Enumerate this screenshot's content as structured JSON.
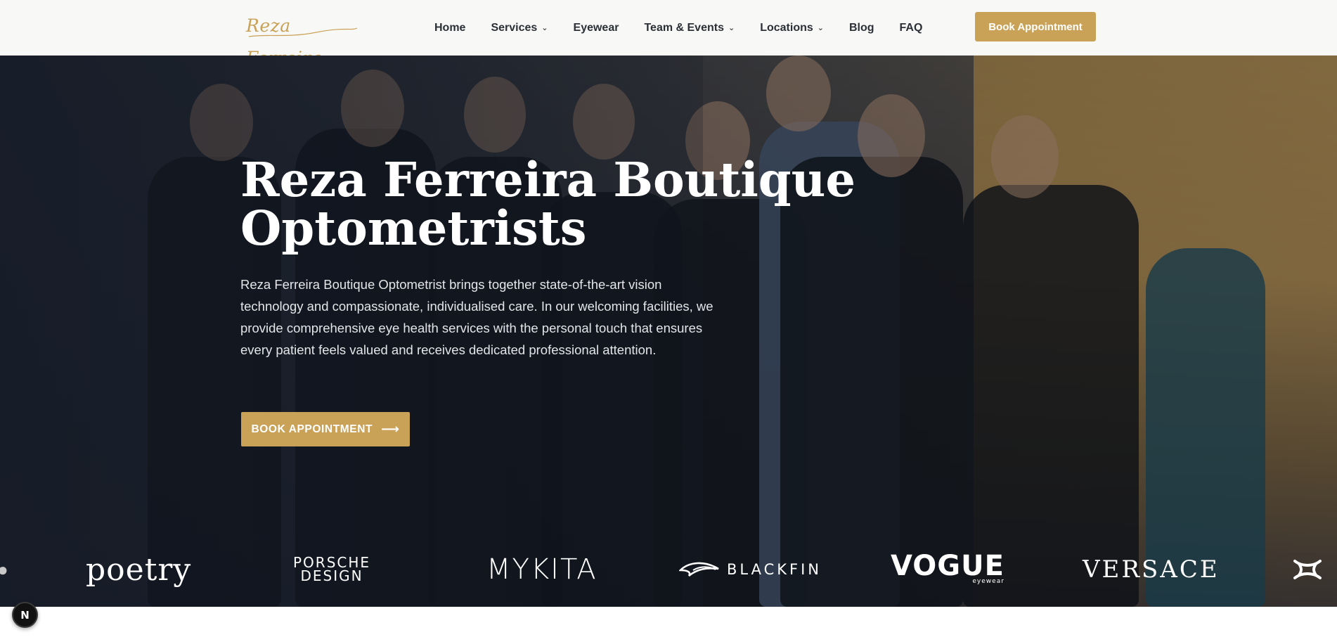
{
  "header": {
    "logo_text": "Reza Ferreira",
    "nav": [
      {
        "label": "Home",
        "has_dropdown": false
      },
      {
        "label": "Services",
        "has_dropdown": true
      },
      {
        "label": "Eyewear",
        "has_dropdown": false
      },
      {
        "label": "Team & Events",
        "has_dropdown": true
      },
      {
        "label": "Locations",
        "has_dropdown": true
      },
      {
        "label": "Blog",
        "has_dropdown": false
      },
      {
        "label": "FAQ",
        "has_dropdown": false
      }
    ],
    "dropdown_icon": "chevron-down-icon",
    "book_button": "Book Appointment"
  },
  "hero": {
    "title_line1": "Reza Ferreira Boutique",
    "title_line2": "Optometrists",
    "description": "Reza Ferreira Boutique Optometrist brings together state-of-the-art vision technology and compassionate, individualised care. In our welcoming facilities, we provide comprehensive eye health services with the personal touch that ensures every patient feels valued and receives dedicated professional attention.",
    "cta_label": "BOOK APPOINTMENT",
    "cta_icon": "arrow-right-icon"
  },
  "brands": {
    "poetry": "poetry",
    "porsche_line1": "PORSCHE",
    "porsche_line2": "DESIGN",
    "mykita": "MYKITA",
    "blackfin": "BLACKFIN",
    "vogue": "VOGUE",
    "vogue_sub": "eyewear",
    "versace": "VERSACE"
  },
  "badge": {
    "letter": "N"
  },
  "colors": {
    "accent_gold": "#c9a257",
    "header_bg": "#f8f8f7",
    "nav_text": "#2b2f36",
    "hero_text": "#ffffff"
  }
}
